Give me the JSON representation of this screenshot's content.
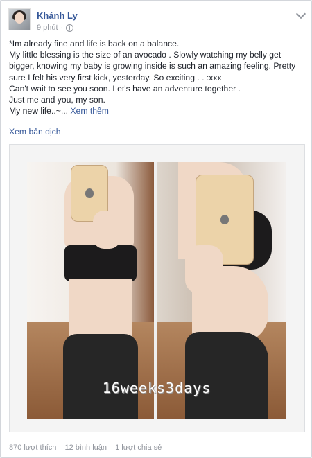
{
  "post": {
    "author": "Khánh Ly",
    "time": "9 phút",
    "separator": "·",
    "lines": [
      "*Im already fine and life is back on a balance.",
      "My little blessing is the size of an avocado . Slowly watching my belly get bigger, knowing my baby is growing inside is such an amazing feeling. Pretty sure I felt his very first kick, yesterday. So exciting . . :xxx",
      "Can't wait to see you soon. Let's have an adventure together .",
      "Just me and you, my son.",
      "My new life..~..."
    ],
    "see_more": "Xem thêm",
    "translate": "Xem bản dịch",
    "photo_caption": "16weeks3days"
  },
  "stats": {
    "likes": "870 lượt thích",
    "comments": "12 bình luận",
    "shares": "1 lượt chia sẻ"
  }
}
